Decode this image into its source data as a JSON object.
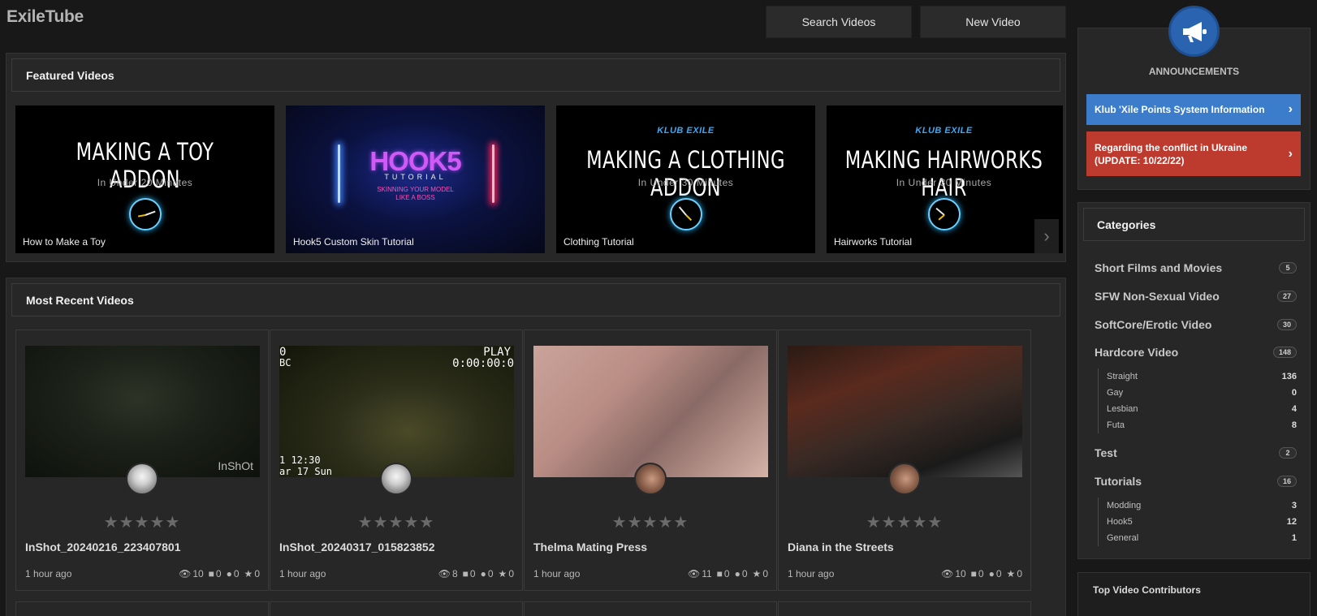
{
  "site": {
    "title": "ExileTube"
  },
  "toolbar": {
    "search_label": "Search Videos",
    "new_label": "New Video"
  },
  "featured": {
    "heading": "Featured Videos",
    "items": [
      {
        "caption": "How to Make a Toy",
        "brand": "",
        "title": "MAKING A TOY  ADDON",
        "sub": "In Under 20 Minutes"
      },
      {
        "caption": "Hook5 Custom Skin Tutorial",
        "word": "HOOK5",
        "sub": "TUTORIAL",
        "tag1": "SKINNING YOUR MODEL",
        "tag2": "LIKE A BOSS"
      },
      {
        "caption": "Clothing Tutorial",
        "brand": "KLUB EXILE",
        "title": "MAKING A CLOTHING ADDON",
        "sub": "In Under 30 Minutes"
      },
      {
        "caption": "Hairworks Tutorial",
        "brand": "KLUB EXILE",
        "title": "MAKING HAIRWORKS HAIR",
        "sub": "In Under 30 Minutes"
      }
    ]
  },
  "recent": {
    "heading": "Most Recent Videos",
    "items": [
      {
        "title": "InShot_20240216_223407801",
        "time": "1 hour ago",
        "views": "10",
        "videos": "0",
        "comments": "0",
        "favs": "0",
        "overlay": "InShOt"
      },
      {
        "title": "InShot_20240317_015823852",
        "time": "1 hour ago",
        "views": "8",
        "videos": "0",
        "comments": "0",
        "favs": "0",
        "ov_tl": "0",
        "ov_bc": "BC",
        "ov_play": "PLAY",
        "ov_counter": "0:00:00:0",
        "ov_time": "1 12:30",
        "ov_date": "ar 17 Sun"
      },
      {
        "title": "Thelma Mating Press",
        "time": "1 hour ago",
        "views": "11",
        "videos": "0",
        "comments": "0",
        "favs": "0"
      },
      {
        "title": "Diana in the Streets",
        "time": "1 hour ago",
        "views": "10",
        "videos": "0",
        "comments": "0",
        "favs": "0"
      }
    ]
  },
  "announcements": {
    "label": "ANNOUNCEMENTS",
    "items": [
      {
        "text": "Klub 'Xile Points System Information"
      },
      {
        "text": "Regarding the conflict in Ukraine (UPDATE: 10/22/22)"
      }
    ]
  },
  "categories": {
    "heading": "Categories",
    "items": [
      {
        "name": "Short Films and Movies",
        "count": "5"
      },
      {
        "name": "SFW Non-Sexual Video",
        "count": "27"
      },
      {
        "name": "SoftCore/Erotic Video",
        "count": "30"
      },
      {
        "name": "Hardcore Video",
        "count": "148"
      },
      {
        "name": "Test",
        "count": "2"
      },
      {
        "name": "Tutorials",
        "count": "16"
      }
    ],
    "hardcore_sub": [
      {
        "name": "Straight",
        "count": "136"
      },
      {
        "name": "Gay",
        "count": "0"
      },
      {
        "name": "Lesbian",
        "count": "4"
      },
      {
        "name": "Futa",
        "count": "8"
      }
    ],
    "tutorials_sub": [
      {
        "name": "Modding",
        "count": "3"
      },
      {
        "name": "Hook5",
        "count": "12"
      },
      {
        "name": "General",
        "count": "1"
      }
    ]
  },
  "contributors": {
    "heading": "Top Video Contributors"
  },
  "icons": {
    "views": "eye-icon",
    "videos": "video-camera-icon",
    "comments": "comments-icon",
    "favs": "star-icon",
    "next": "chevron-right-icon",
    "announce": "megaphone-icon"
  },
  "colors": {
    "accent_blue": "#3c7dcb",
    "alert_red": "#bd3b2e",
    "megaphone_bg": "#2a64b0"
  }
}
